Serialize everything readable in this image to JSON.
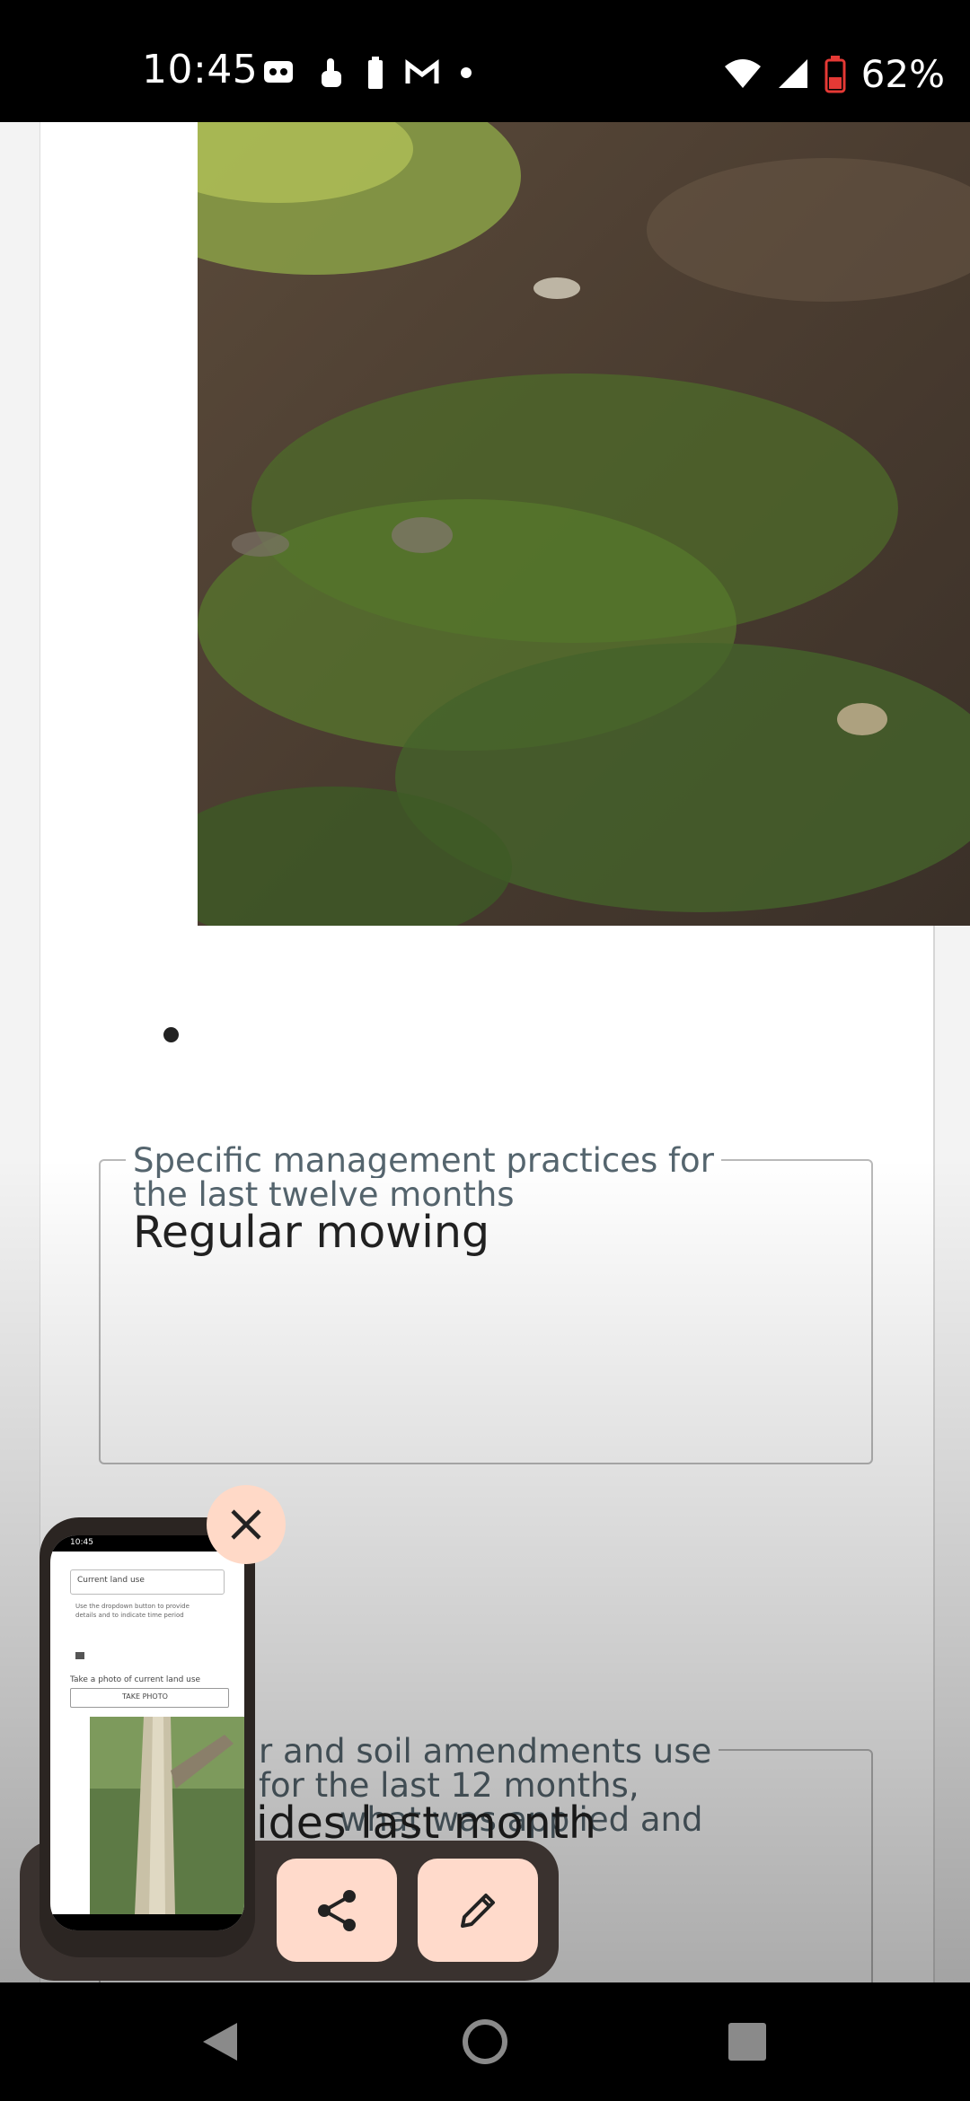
{
  "status_bar": {
    "time": "10:45",
    "battery_percent": "62%",
    "left_icons": [
      "app-icon",
      "touch-icon",
      "battery-small-icon",
      "gmail-icon",
      "dot-icon"
    ],
    "right_icons": [
      "wifi-icon",
      "signal-icon",
      "battery-low-icon"
    ]
  },
  "form": {
    "photo_alt": "photo of grass and soil",
    "field1": {
      "label_line1": "Specific management practices for",
      "label_line2": "the last twelve months",
      "value": "Regular mowing"
    },
    "field2": {
      "label_line1": "r and soil amendments use",
      "label_line2": "for the last 12 months,",
      "label_line3": "what was applied and",
      "value_partial": "ides last month"
    }
  },
  "screenshot_preview": {
    "mini_time": "10:45",
    "mini_dropdown": "Current land use",
    "mini_hint": "Use the dropdown button to provide details and to indicate time period",
    "mini_photo_label": "Take a photo of current land use",
    "mini_take_photo": "TAKE PHOTO"
  },
  "actions": {
    "share_icon": "share-icon",
    "edit_icon": "edit-icon",
    "close_icon": "close-icon"
  },
  "colors": {
    "accent_button": "#ffdacb",
    "toolbar_bg": "#3a322f",
    "label_text": "#55656e"
  }
}
